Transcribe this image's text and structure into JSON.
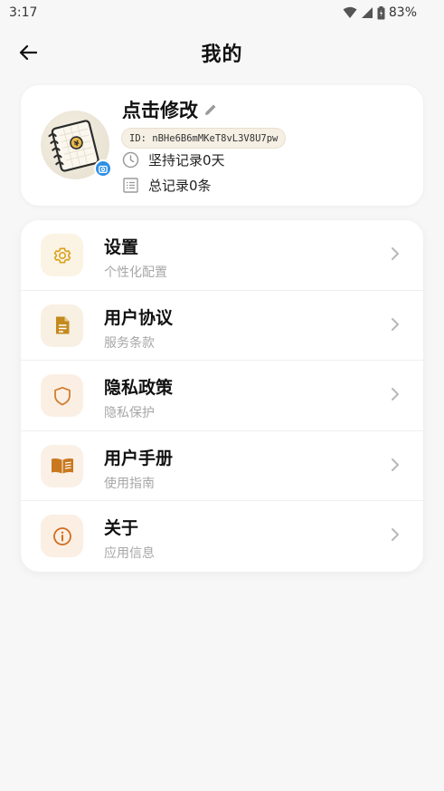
{
  "status": {
    "time": "3:17",
    "battery": "83%"
  },
  "header": {
    "title": "我的"
  },
  "profile": {
    "nickname": "点击修改",
    "id_text": "ID: nBHe6B6mMKeT8vL3V8U7pw",
    "days_text": "坚持记录0天",
    "total_text": "总记录0条"
  },
  "menu": [
    {
      "title": "设置",
      "subtitle": "个性化配置",
      "icon": "gear-icon",
      "color": "#d9a21b",
      "bg": "#fbf3e3"
    },
    {
      "title": "用户协议",
      "subtitle": "服务条款",
      "icon": "document-icon",
      "color": "#c48a1f",
      "bg": "#f8f0e2"
    },
    {
      "title": "隐私政策",
      "subtitle": "隐私保护",
      "icon": "shield-icon",
      "color": "#d27d2d",
      "bg": "#fbefe4"
    },
    {
      "title": "用户手册",
      "subtitle": "使用指南",
      "icon": "book-icon",
      "color": "#c9781f",
      "bg": "#faf0e6"
    },
    {
      "title": "关于",
      "subtitle": "应用信息",
      "icon": "info-icon",
      "color": "#d06d1f",
      "bg": "#fbeee3"
    }
  ]
}
